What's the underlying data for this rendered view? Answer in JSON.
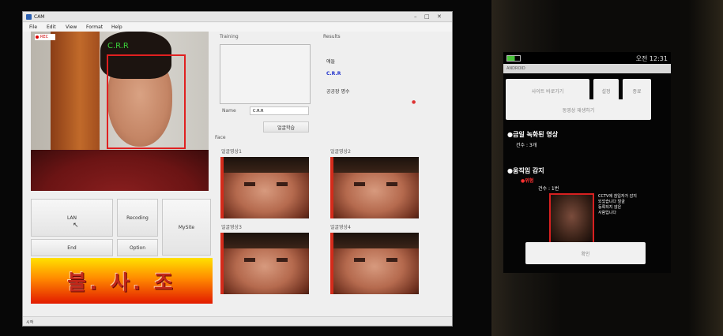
{
  "window": {
    "title": "CAM",
    "menu": [
      "File",
      "Edit",
      "View",
      "Format",
      "Help"
    ],
    "camera": {
      "rec_label": "REC",
      "detected_name": "C.R.R"
    },
    "buttons": {
      "left_top": "LAN",
      "recording": "Recoding",
      "mysite": "MySite",
      "end": "End",
      "option": "Option"
    },
    "banner": "불. 사. 조",
    "training": {
      "label": "Training",
      "name_label": "Name",
      "name_value": "C.R.R",
      "register_button": "얼굴학습"
    },
    "results": {
      "label": "Results",
      "line1": "얘들",
      "line2": "C.R.R",
      "line3": "공공장 명수"
    },
    "face": {
      "label": "Face",
      "tiles": [
        "얼굴영상1",
        "얼굴영상2",
        "얼굴영상3",
        "얼굴영상4"
      ]
    },
    "status": "시작"
  },
  "phone": {
    "clock": "오전 12:31",
    "app_title": "ANDROID",
    "buttons": [
      "사이트 바로가기",
      "설정",
      "종료",
      "동영상 재생하기"
    ],
    "recorded_heading": "●금일 녹화된 영상",
    "recorded_count": "건수 : 3개",
    "detected_heading": "●움직임 감지",
    "detected_sub": "●위험",
    "detected_count": "건수 : 1번",
    "detected_note": [
      "CCTV에 침입자가 감지",
      "되었습니다 얼굴",
      "등록되지 않은",
      "사람입니다"
    ],
    "confirm_button": "확인"
  }
}
